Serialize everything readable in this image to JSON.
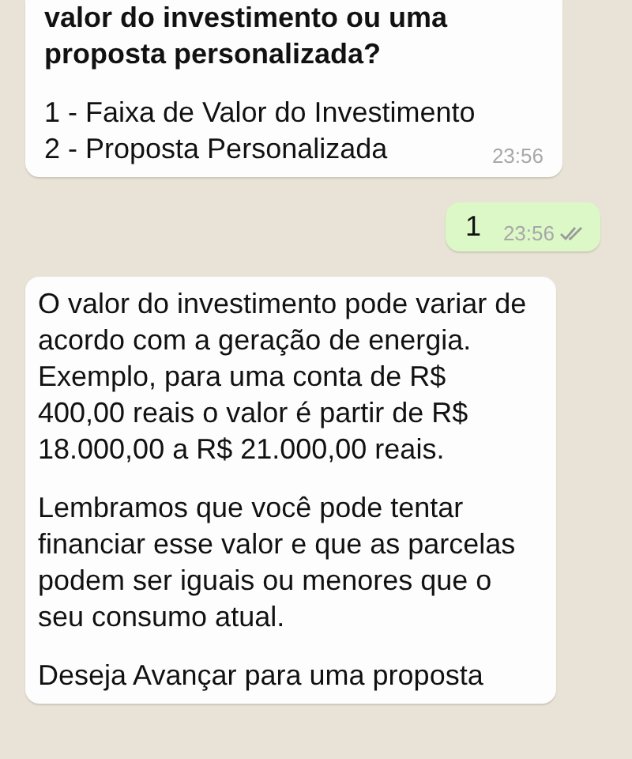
{
  "messages": [
    {
      "kind": "incoming",
      "paragraphs": [
        {
          "text": "valor do investimento ou uma proposta personalizada?",
          "bold": true
        },
        {
          "text": "1 - Faixa de Valor do Investimento\n2 - Proposta Personalizada",
          "bold": false
        }
      ],
      "time": "23:56"
    },
    {
      "kind": "outgoing",
      "paragraphs": [
        {
          "text": "1",
          "bold": false
        }
      ],
      "time": "23:56",
      "read": false
    },
    {
      "kind": "incoming",
      "paragraphs": [
        {
          "text": "O valor do investimento pode variar de acordo com a geração de energia. Exemplo, para uma conta de R$ 400,00 reais o valor é partir de R$ 18.000,00 a R$ 21.000,00 reais.",
          "bold": false
        },
        {
          "text": "Lembramos que você pode tentar financiar esse valor e que as parcelas podem ser iguais ou menores que o seu consumo atual.",
          "bold": false
        },
        {
          "text": "Deseja Avançar para uma proposta",
          "bold": false
        }
      ]
    }
  ]
}
